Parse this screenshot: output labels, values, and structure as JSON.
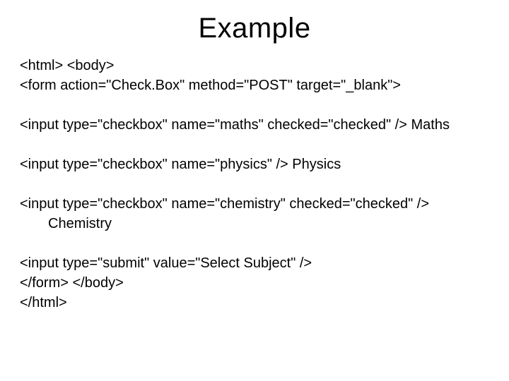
{
  "title": "Example",
  "lines": {
    "l1": "<html> <body>",
    "l2": "<form action=\"Check.Box\" method=\"POST\" target=\"_blank\">",
    "l3": "<input type=\"checkbox\" name=\"maths\" checked=\"checked\" /> Maths",
    "l4": "<input type=\"checkbox\" name=\"physics\" /> Physics",
    "l5": "<input type=\"checkbox\" name=\"chemistry\" checked=\"checked\" />",
    "l5b": "Chemistry",
    "l6": "<input type=\"submit\" value=\"Select Subject\" />",
    "l7": "</form> </body>",
    "l8": "</html>"
  }
}
